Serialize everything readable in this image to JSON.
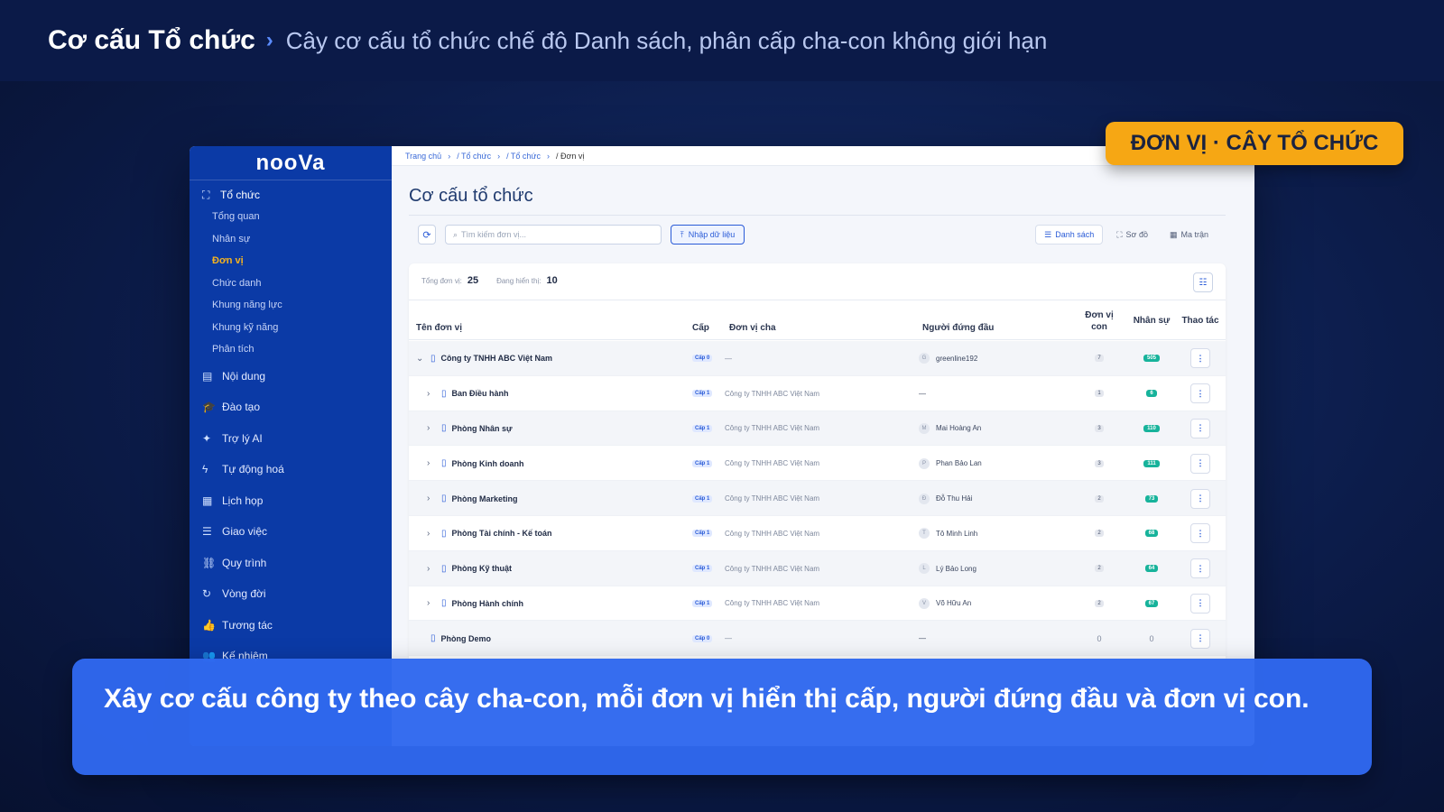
{
  "header": {
    "title": "Cơ cấu Tổ chức",
    "separator": "›",
    "subtitle": "Cây cơ cấu tổ chức chế độ Danh sách, phân cấp cha-con không giới hạn"
  },
  "badge": "ĐƠN VỊ · CÂY TỔ CHỨC",
  "caption": "Xây cơ cấu công ty theo cây cha-con, mỗi đơn vị hiển thị cấp, người đứng đầu và đơn vị con.",
  "sidebar": {
    "logo": "nooVa",
    "group": "Tổ chức",
    "sub_items": [
      "Tổng quan",
      "Nhân sự",
      "Đơn vị",
      "Chức danh",
      "Khung năng lực",
      "Khung kỹ năng",
      "Phân tích"
    ],
    "active_sub": "Đơn vị",
    "items": [
      "Nội dung",
      "Đào tạo",
      "Trợ lý AI",
      "Tự động hoá",
      "Lịch họp",
      "Giao việc",
      "Quy trình",
      "Vòng đời",
      "Tương tác",
      "Kế nhiệm"
    ]
  },
  "breadcrumb": [
    "Trang chủ",
    "/ Tổ chức",
    "/ Tổ chức",
    "/ Đơn vị"
  ],
  "page": {
    "title": "Cơ cấu tổ chức",
    "search_placeholder": "Tìm kiếm đơn vị...",
    "import_label": "Nhập dữ liệu",
    "views": [
      "Danh sách",
      "Sơ đồ",
      "Ma trận"
    ],
    "active_view": "Danh sách",
    "stats": {
      "total_label": "Tổng đơn vị:",
      "total": "25",
      "shown_label": "Đang hiển thị:",
      "shown": "10"
    }
  },
  "table": {
    "columns": {
      "name": "Tên đơn vị",
      "level": "Cấp",
      "parent": "Đơn vị cha",
      "head": "Người đứng đầu",
      "children": "Đơn vị con",
      "staff": "Nhân sự",
      "actions": "Thao tác"
    },
    "rows": [
      {
        "name": "Công ty TNHH ABC Việt Nam",
        "level": "Cấp 0",
        "parent": "—",
        "head_initial": "G",
        "head": "greenline192",
        "children": "7",
        "staff": "505",
        "expand": "⌄",
        "indent": 0
      },
      {
        "name": "Ban Điều hành",
        "level": "Cấp 1",
        "parent": "Công ty TNHH ABC Việt Nam",
        "head_initial": "",
        "head": "—",
        "children": "1",
        "staff": "6",
        "expand": "›",
        "indent": 1
      },
      {
        "name": "Phòng Nhân sự",
        "level": "Cấp 1",
        "parent": "Công ty TNHH ABC Việt Nam",
        "head_initial": "M",
        "head": "Mai Hoàng An",
        "children": "3",
        "staff": "110",
        "expand": "›",
        "indent": 1
      },
      {
        "name": "Phòng Kinh doanh",
        "level": "Cấp 1",
        "parent": "Công ty TNHH ABC Việt Nam",
        "head_initial": "P",
        "head": "Phan Bảo Lan",
        "children": "3",
        "staff": "111",
        "expand": "›",
        "indent": 1
      },
      {
        "name": "Phòng Marketing",
        "level": "Cấp 1",
        "parent": "Công ty TNHH ABC Việt Nam",
        "head_initial": "Đ",
        "head": "Đỗ Thu Hải",
        "children": "2",
        "staff": "73",
        "expand": "›",
        "indent": 1
      },
      {
        "name": "Phòng Tài chính - Kế toán",
        "level": "Cấp 1",
        "parent": "Công ty TNHH ABC Việt Nam",
        "head_initial": "T",
        "head": "Tô Minh Linh",
        "children": "2",
        "staff": "68",
        "expand": "›",
        "indent": 1
      },
      {
        "name": "Phòng Kỹ thuật",
        "level": "Cấp 1",
        "parent": "Công ty TNHH ABC Việt Nam",
        "head_initial": "L",
        "head": "Lý Bảo Long",
        "children": "2",
        "staff": "64",
        "expand": "›",
        "indent": 1
      },
      {
        "name": "Phòng Hành chính",
        "level": "Cấp 1",
        "parent": "Công ty TNHH ABC Việt Nam",
        "head_initial": "V",
        "head": "Võ Hữu An",
        "children": "2",
        "staff": "67",
        "expand": "›",
        "indent": 1
      },
      {
        "name": "Phòng Demo",
        "level": "Cấp 0",
        "parent": "—",
        "head_initial": "",
        "head": "—",
        "children": "0",
        "staff": "0",
        "expand": "",
        "indent": 0
      }
    ]
  }
}
